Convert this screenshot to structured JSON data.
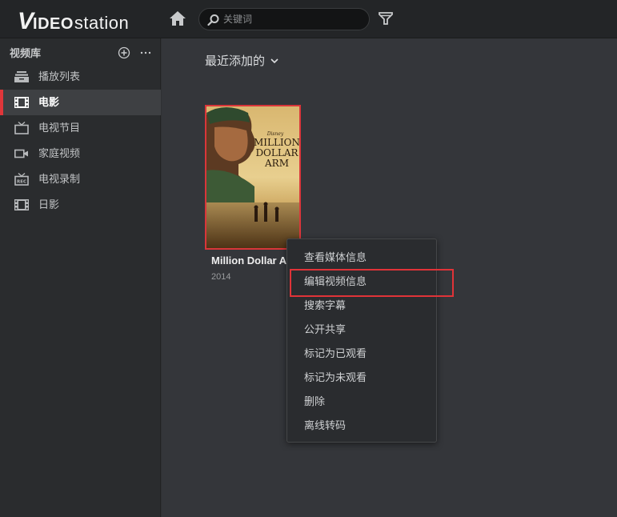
{
  "app": {
    "logo_v": "V",
    "logo_ideo": "IDEO",
    "logo_station": "station"
  },
  "toolbar": {
    "home_icon": "home-icon",
    "search_placeholder": "关键词",
    "search_value": "",
    "filter_icon": "filter-icon"
  },
  "sidebar": {
    "library_title": "视频库",
    "items": [
      {
        "label": "播放列表",
        "icon": "playlist-icon",
        "active": false
      },
      {
        "label": "电影",
        "icon": "film-icon",
        "active": true
      },
      {
        "label": "电视节目",
        "icon": "tv-icon",
        "active": false
      },
      {
        "label": "家庭视频",
        "icon": "camera-icon",
        "active": false
      },
      {
        "label": "电视录制",
        "icon": "rec-icon",
        "active": false
      },
      {
        "label": "日影",
        "icon": "film-icon",
        "active": false
      }
    ]
  },
  "main": {
    "section_title": "最近添加的",
    "movie": {
      "title": "Million Dollar A",
      "year": "2014",
      "poster_brand": "Disney",
      "poster_title_1": "MILLION",
      "poster_title_2": "DOLLAR",
      "poster_title_3": "ARM"
    }
  },
  "context_menu": {
    "items": [
      "查看媒体信息",
      "编辑视频信息",
      "搜索字幕",
      "公开共享",
      "标记为已观看",
      "标记为未观看",
      "删除",
      "离线转码"
    ],
    "highlighted_index": 1
  },
  "colors": {
    "accent": "#e0363a",
    "topbar": "#232527",
    "sidebar": "#2a2c2e",
    "main": "#34363a"
  }
}
